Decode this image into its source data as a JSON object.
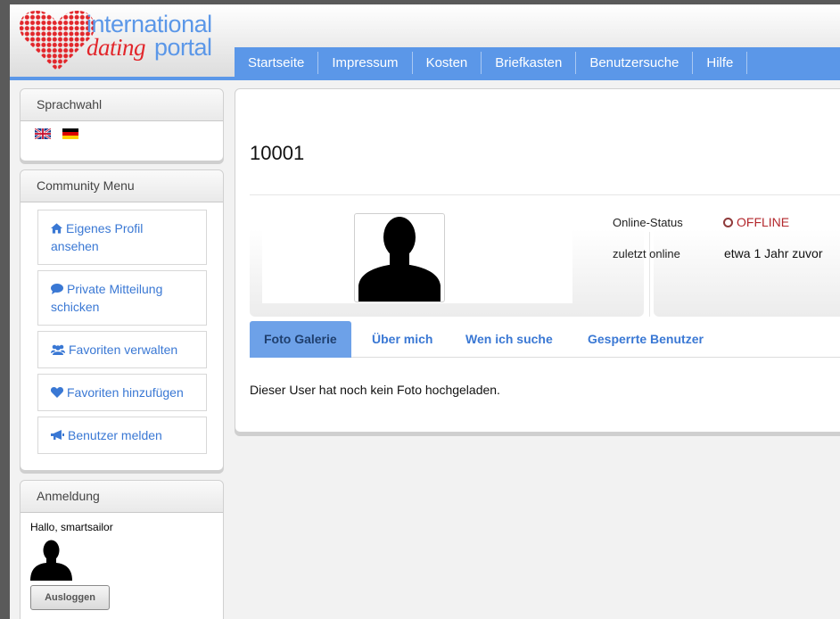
{
  "logo": {
    "line1": "international",
    "word_dating": "dating",
    "word_portal": "portal"
  },
  "colors": {
    "accent": "#5b97e8",
    "heart": "#e2262b",
    "link": "#3a78d4",
    "offline": "#b3282d"
  },
  "nav": [
    {
      "label": "Startseite"
    },
    {
      "label": "Impressum"
    },
    {
      "label": "Kosten"
    },
    {
      "label": "Briefkasten"
    },
    {
      "label": "Benutzersuche"
    },
    {
      "label": "Hilfe"
    }
  ],
  "language_panel": {
    "title": "Sprachwahl",
    "flags": [
      "uk-flag-icon",
      "germany-flag-icon"
    ]
  },
  "community_menu": {
    "title": "Community Menu",
    "items": [
      {
        "label": "Eigenes Profil ansehen",
        "icon": "home-icon"
      },
      {
        "label": "Private Mitteilung schicken",
        "icon": "speech-bubble-icon"
      },
      {
        "label": "Favoriten verwalten",
        "icon": "users-icon"
      },
      {
        "label": "Favoriten hinzufügen",
        "icon": "heart-icon"
      },
      {
        "label": "Benutzer melden",
        "icon": "megaphone-icon"
      }
    ]
  },
  "login_panel": {
    "title": "Anmeldung",
    "greeting": "Hallo, smartsailor",
    "logout_label": "Ausloggen"
  },
  "profile": {
    "id": "10001",
    "online_status_label": "Online-Status",
    "online_status_value": "OFFLINE",
    "last_online_label": "zuletzt online",
    "last_online_value": "etwa 1 Jahr zuvor"
  },
  "tabs": [
    {
      "label": "Foto Galerie",
      "active": true
    },
    {
      "label": "Über mich",
      "active": false
    },
    {
      "label": "Wen ich suche",
      "active": false
    },
    {
      "label": "Gesperrte Benutzer",
      "active": false
    }
  ],
  "gallery_message": "Dieser User hat noch kein Foto hochgeladen."
}
